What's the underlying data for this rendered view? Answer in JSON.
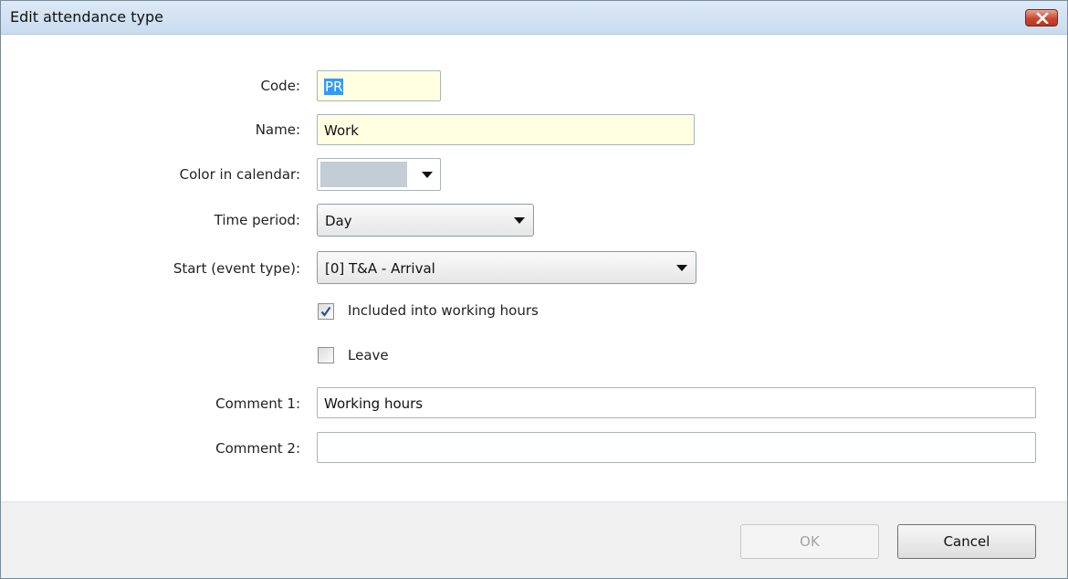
{
  "window": {
    "title": "Edit attendance type"
  },
  "form": {
    "code_label": "Code:",
    "code_value": "PR",
    "name_label": "Name:",
    "name_value": "Work",
    "color_label": "Color in calendar:",
    "color_value": "#c4ccd6",
    "time_period_label": "Time period:",
    "time_period_value": "Day",
    "start_label": "Start (event type):",
    "start_value": "[0]  T&A - Arrival",
    "included_label": "Included into working hours",
    "included_checked": true,
    "leave_label": "Leave",
    "leave_checked": false,
    "comment1_label": "Comment 1:",
    "comment1_value": "Working hours",
    "comment2_label": "Comment 2:",
    "comment2_value": ""
  },
  "footer": {
    "ok_label": "OK",
    "cancel_label": "Cancel"
  },
  "colors": {
    "title_bar": "#c9dcef",
    "close_button": "#c9472e",
    "required_field_bg": "#ffffe1",
    "selection": "#3399ff"
  },
  "icons": {
    "close": "close-icon",
    "dropdown": "chevron-down-icon",
    "check": "checkmark-icon"
  }
}
